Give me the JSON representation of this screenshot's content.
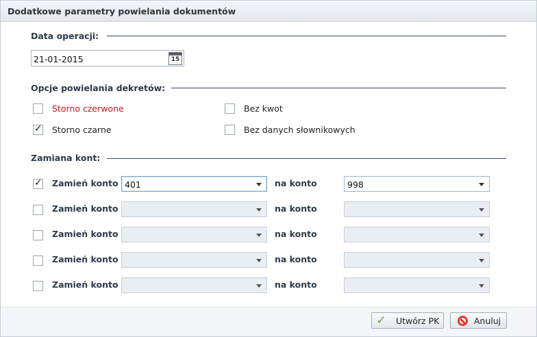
{
  "dialog": {
    "title": "Dodatkowe parametry powielania dokumentów"
  },
  "operation_date": {
    "heading": "Data operacji:",
    "value": "21-01-2015",
    "calendar_icon_text": "15"
  },
  "options": {
    "heading": "Opcje powielania dekretów:",
    "items": [
      {
        "label": "Storno czerwone",
        "checked": false
      },
      {
        "label": "Bez kwot",
        "checked": false
      },
      {
        "label": "Storno czarne",
        "checked": true
      },
      {
        "label": "Bez danych słownikowych",
        "checked": false
      }
    ]
  },
  "account_swap": {
    "heading": "Zamiana kont:",
    "row_label": "Zamień konto",
    "to_label": "na konto",
    "rows": [
      {
        "checked": true,
        "from": "401",
        "to": "998"
      },
      {
        "checked": false,
        "from": "",
        "to": ""
      },
      {
        "checked": false,
        "from": "",
        "to": ""
      },
      {
        "checked": false,
        "from": "",
        "to": ""
      },
      {
        "checked": false,
        "from": "",
        "to": ""
      }
    ]
  },
  "footer": {
    "create_label": "Utwórz PK",
    "cancel_label": "Anuluj"
  },
  "colors": {
    "accent_red": "#d0141a",
    "check_green": "#6aa84f",
    "cancel_red": "#e33b2d"
  }
}
